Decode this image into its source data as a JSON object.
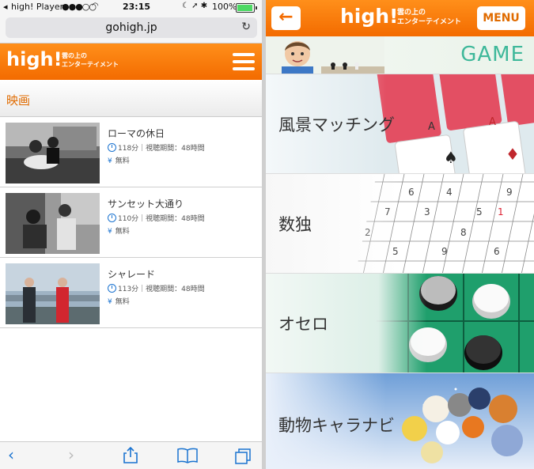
{
  "status_bar": {
    "back_app": "high! Player",
    "signal": "●●●○○",
    "time": "23:15",
    "battery": "100%"
  },
  "browser": {
    "url": "gohigh.jp",
    "toolbar": [
      "back",
      "forward",
      "share",
      "bookmarks",
      "tabs"
    ]
  },
  "site": {
    "logo": "high!",
    "tagline_line1": "雲の上の",
    "tagline_line2": "エンターテイメント",
    "section_title": "映画"
  },
  "movies": [
    {
      "title": "ローマの休日",
      "info": "118分｜視聴期間：48時間",
      "price": "無料"
    },
    {
      "title": "サンセット大通り",
      "info": "110分｜視聴期間：48時間",
      "price": "無料"
    },
    {
      "title": "シャレード",
      "info": "113分｜視聴期間：48時間",
      "price": "無料"
    }
  ],
  "right": {
    "back_symbol": "←",
    "menu_label": "MENU",
    "banner_label": "GAME",
    "games": [
      {
        "label": "風景マッチング"
      },
      {
        "label": "数独"
      },
      {
        "label": "オセロ"
      },
      {
        "label": "動物キャラナビ"
      }
    ]
  },
  "colors": {
    "brand_orange": "#f36b00",
    "link_blue": "#1a73d0",
    "game_teal": "#3eb89a"
  }
}
